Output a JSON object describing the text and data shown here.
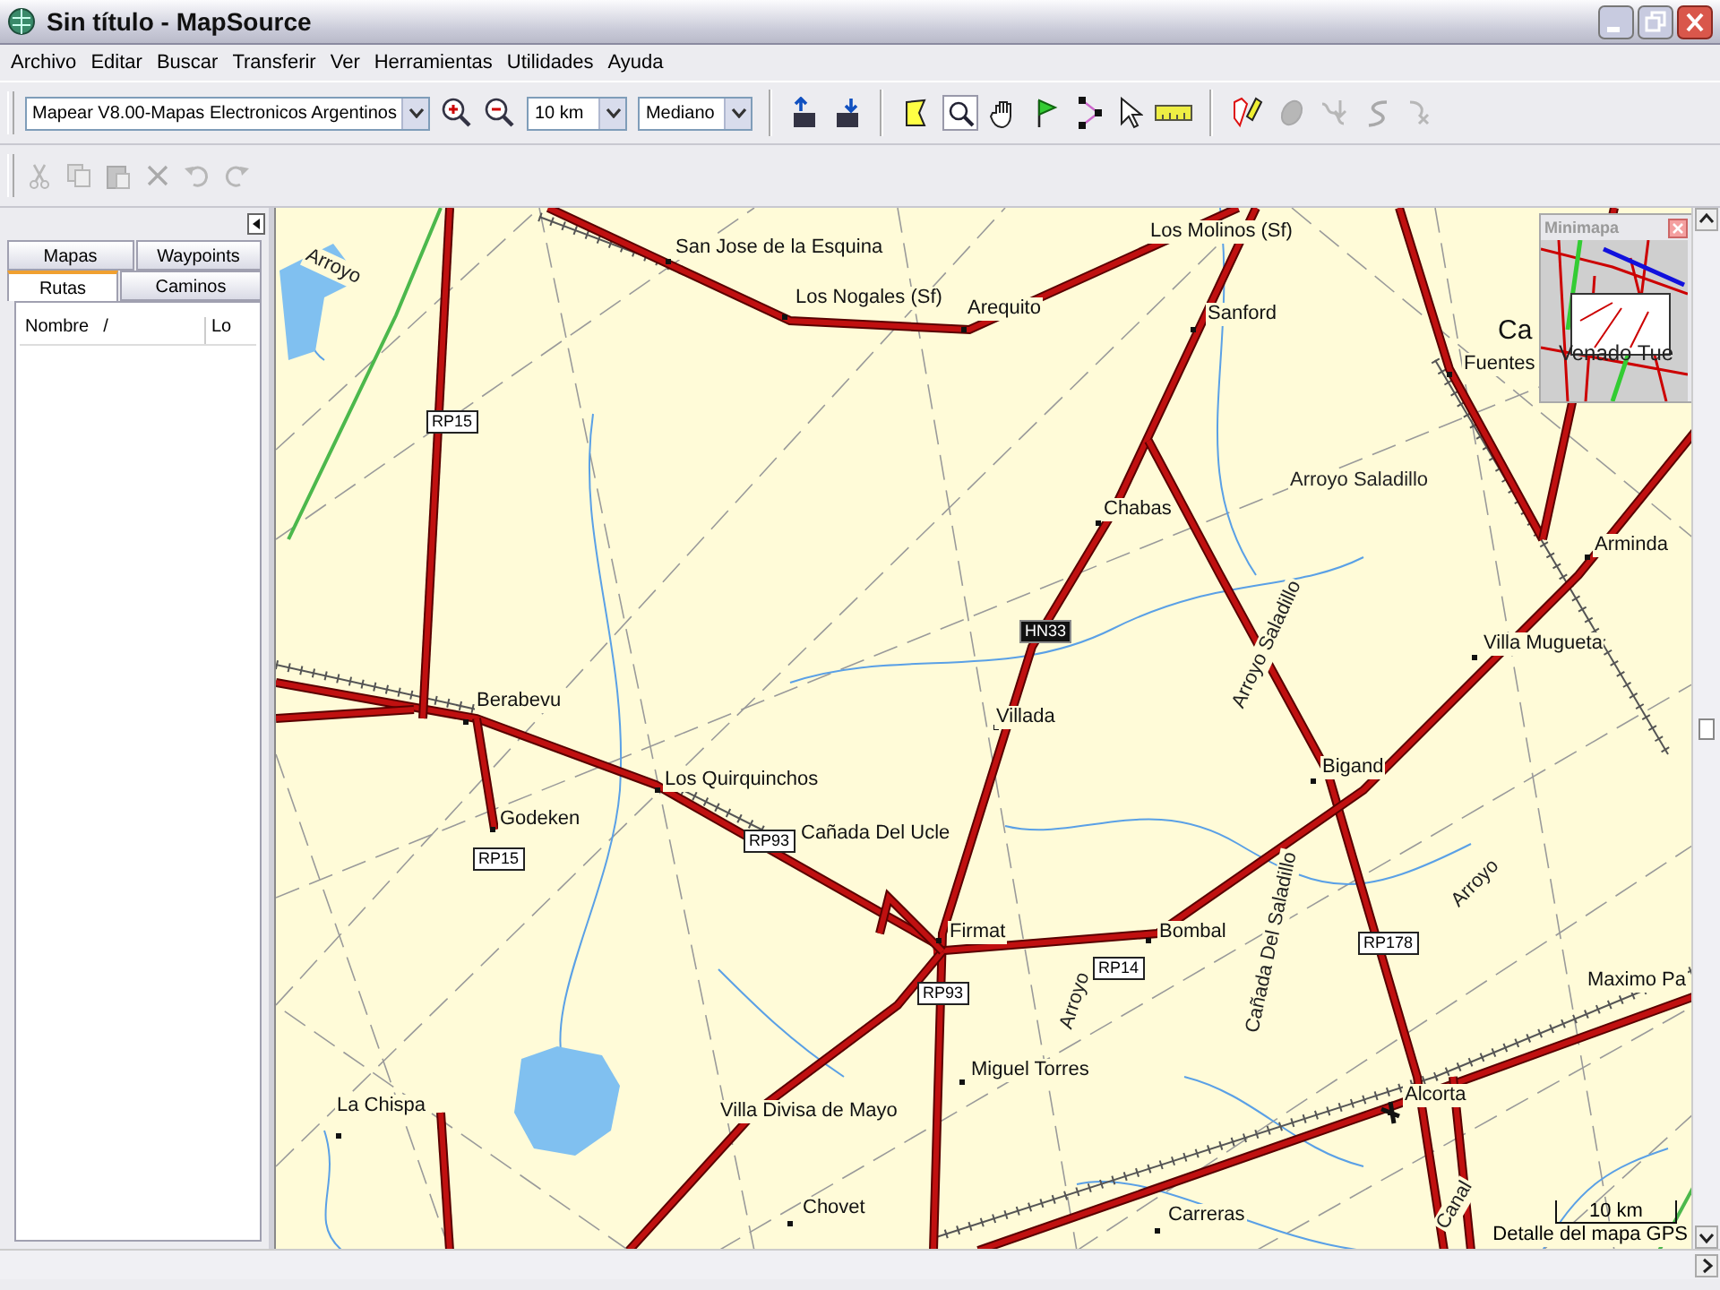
{
  "window": {
    "title": "Sin título - MapSource"
  },
  "menu": [
    "Archivo",
    "Editar",
    "Buscar",
    "Transferir",
    "Ver",
    "Herramientas",
    "Utilidades",
    "Ayuda"
  ],
  "toolbar": {
    "product": "Mapear V8.00-Mapas Electronicos Argentinos",
    "zoom_scale": "10 km",
    "detail": "Mediano"
  },
  "side_panel": {
    "tabs": [
      {
        "label": "Mapas",
        "selected": false
      },
      {
        "label": "Waypoints",
        "selected": false
      },
      {
        "label": "Rutas",
        "selected": true
      },
      {
        "label": "Caminos",
        "selected": false
      }
    ],
    "columns": [
      {
        "label": "Nombre",
        "sort_mark": "/"
      },
      {
        "label": "Lo"
      }
    ]
  },
  "minimap": {
    "title": "Minimapa",
    "label": "Venado Tue"
  },
  "map": {
    "labels": [
      {
        "text": "Arroyo",
        "kind": "water"
      },
      {
        "text": "San Jose de la Esquina",
        "kind": "place"
      },
      {
        "text": "Los Molinos (Sf)",
        "kind": "place"
      },
      {
        "text": "Los Nogales (Sf)",
        "kind": "place"
      },
      {
        "text": "Arequito",
        "kind": "place"
      },
      {
        "text": "Sanford",
        "kind": "place"
      },
      {
        "text": "Ca",
        "kind": "city"
      },
      {
        "text": "Fuentes",
        "kind": "place"
      },
      {
        "text": "RP15",
        "kind": "road"
      },
      {
        "text": "Arroyo Saladillo",
        "kind": "water"
      },
      {
        "text": "Chabas",
        "kind": "place"
      },
      {
        "text": "Arminda",
        "kind": "place"
      },
      {
        "text": "HN33",
        "kind": "highway"
      },
      {
        "text": "Villa Mugueta",
        "kind": "place"
      },
      {
        "text": "Arroyo Saladillo",
        "kind": "water"
      },
      {
        "text": "Berabevu",
        "kind": "place"
      },
      {
        "text": "Villada",
        "kind": "place"
      },
      {
        "text": "Los Quirquinchos",
        "kind": "place"
      },
      {
        "text": "Bigand",
        "kind": "place"
      },
      {
        "text": "Godeken",
        "kind": "place"
      },
      {
        "text": "RP15",
        "kind": "road"
      },
      {
        "text": "RP93",
        "kind": "road"
      },
      {
        "text": "Cañada Del Ucle",
        "kind": "place"
      },
      {
        "text": "Arroyo",
        "kind": "water"
      },
      {
        "text": "Firmat",
        "kind": "place"
      },
      {
        "text": "Bombal",
        "kind": "place"
      },
      {
        "text": "RP178",
        "kind": "road"
      },
      {
        "text": "Cañada Del Saladillo",
        "kind": "water"
      },
      {
        "text": "Arroyo",
        "kind": "water"
      },
      {
        "text": "RP14",
        "kind": "road"
      },
      {
        "text": "RP93",
        "kind": "road"
      },
      {
        "text": "Maximo Pa",
        "kind": "place"
      },
      {
        "text": "Miguel Torres",
        "kind": "place"
      },
      {
        "text": "La Chispa",
        "kind": "place"
      },
      {
        "text": "Villa Divisa de Mayo",
        "kind": "place"
      },
      {
        "text": "Alcorta",
        "kind": "place"
      },
      {
        "text": "Chovet",
        "kind": "place"
      },
      {
        "text": "Carreras",
        "kind": "place"
      },
      {
        "text": "Canal",
        "kind": "water"
      }
    ],
    "scale": "10 km",
    "detail_note": "Detalle del mapa GPS"
  }
}
